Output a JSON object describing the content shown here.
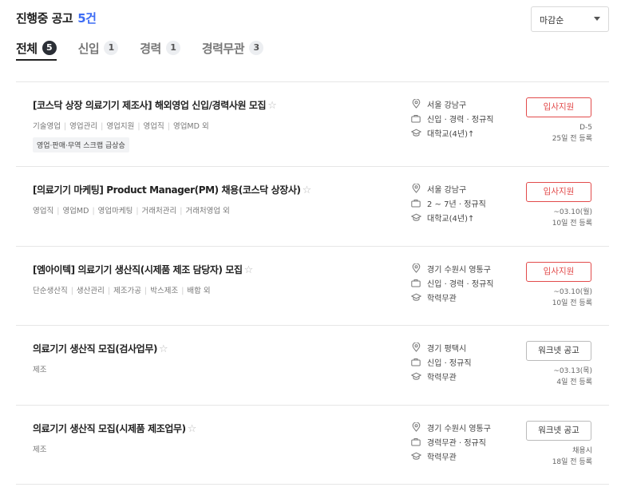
{
  "header": {
    "title": "진행중 공고",
    "count": "5건"
  },
  "sort": {
    "selected": "마감순"
  },
  "tabs": [
    {
      "label": "전체",
      "count": "5",
      "active": true
    },
    {
      "label": "신입",
      "count": "1"
    },
    {
      "label": "경력",
      "count": "1"
    },
    {
      "label": "경력무관",
      "count": "3"
    }
  ],
  "jobs": [
    {
      "title": "[코스닥 상장 의료기기 제조사] 해외영업 신입/경력사원 모집",
      "tags": [
        "기술영업",
        "영업관리",
        "영업지원",
        "영업직",
        "영업MD 외"
      ],
      "chip": "영업·판매·무역 스크랩 급상승",
      "location": "서울 강남구",
      "career": "신입 · 경력 · 정규직",
      "education": "대학교(4년)↑",
      "button": "입사지원",
      "deadline": "D-5",
      "posted": "25일 전 등록"
    },
    {
      "title": "[의료기기 마케팅] Product Manager(PM) 채용(코스닥 상장사)",
      "tags": [
        "영업직",
        "영업MD",
        "영업마케팅",
        "거래처관리",
        "거래처영업 외"
      ],
      "location": "서울 강남구",
      "career": "2 ~ 7년 · 정규직",
      "education": "대학교(4년)↑",
      "button": "입사지원",
      "deadline": "~03.10(월)",
      "posted": "10일 전 등록"
    },
    {
      "title": "[엠아이텍] 의료기기 생산직(시제품 제조 담당자) 모집",
      "tags": [
        "단순생산직",
        "생산관리",
        "제조가공",
        "박스제조",
        "배합 외"
      ],
      "location": "경기 수원시 영통구",
      "career": "신입 · 경력 · 정규직",
      "education": "학력무관",
      "button": "입사지원",
      "deadline": "~03.10(월)",
      "posted": "10일 전 등록"
    },
    {
      "title": "의료기기 생산직 모집(검사업무)",
      "tags": [
        "제조"
      ],
      "location": "경기 평택시",
      "career": "신입 · 정규직",
      "education": "학력무관",
      "button": "워크넷 공고",
      "deadline": "~03.13(목)",
      "posted": "4일 전 등록"
    },
    {
      "title": "의료기기 생산직 모집(시제품 제조업무)",
      "tags": [
        "제조"
      ],
      "location": "경기 수원시 영통구",
      "career": "경력무관 · 정규직",
      "education": "학력무관",
      "button": "워크넷 공고",
      "deadline": "채용시",
      "posted": "18일 전 등록"
    }
  ],
  "colors": {
    "accent": "#3d6cf4",
    "apply": "#e24b4b",
    "active_badge": "#2b2f36"
  },
  "icons": {
    "location": "pin-icon",
    "career": "briefcase-icon",
    "education": "graduation-cap-icon",
    "favorite": "star-outline-icon"
  }
}
